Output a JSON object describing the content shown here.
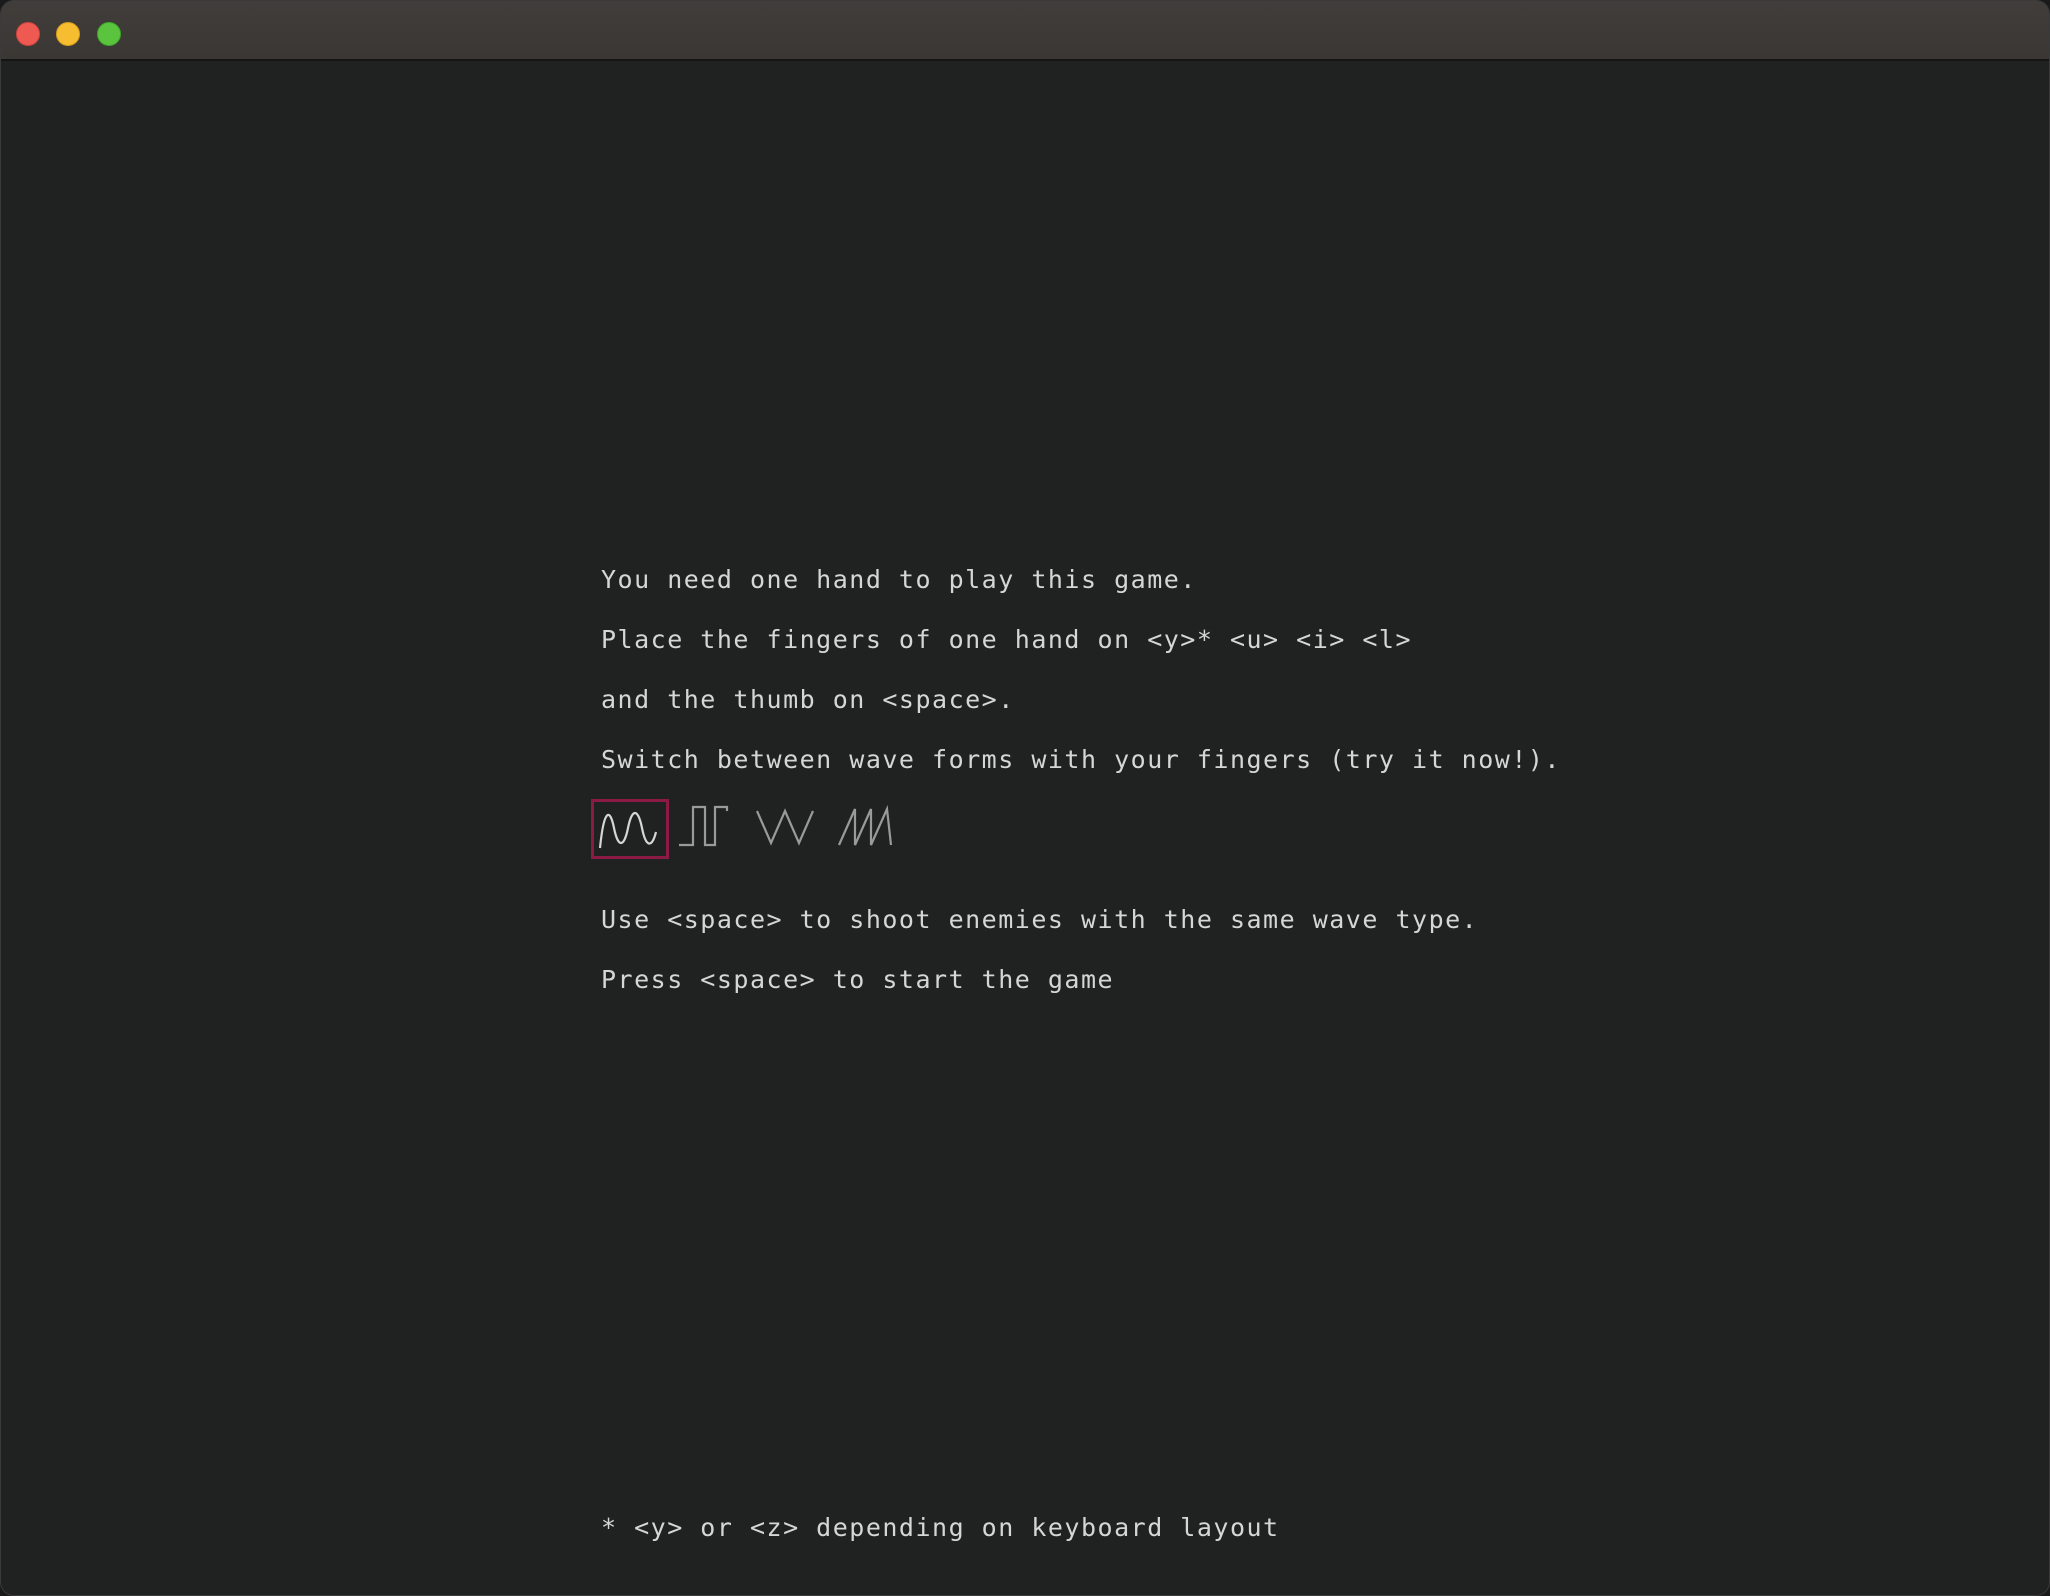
{
  "window": {
    "traffic_lights": [
      "close",
      "minimize",
      "maximize"
    ]
  },
  "instructions": {
    "line1": "You need one hand to play this game.",
    "line2": "Place the fingers of one hand on <y>* <u> <i> <l>",
    "line3": "and the thumb on <space>.",
    "line4": "Switch between wave forms with your fingers (try it now!).",
    "line5": "Use <space> to shoot enemies with the same wave type.",
    "line6": "Press <space> to start the game"
  },
  "waveforms": [
    {
      "icon": "sine-wave-icon",
      "selected": true
    },
    {
      "icon": "square-wave-icon",
      "selected": false
    },
    {
      "icon": "triangle-wave-icon",
      "selected": false
    },
    {
      "icon": "sawtooth-wave-icon",
      "selected": false
    }
  ],
  "colors": {
    "background": "#202221",
    "text": "#d6d6d6",
    "selection": "#8b1a44",
    "wave_selected": "#d6d6d6",
    "wave_unselected": "#9a9a9a"
  },
  "footnote": "* <y> or <z> depending on keyboard layout"
}
